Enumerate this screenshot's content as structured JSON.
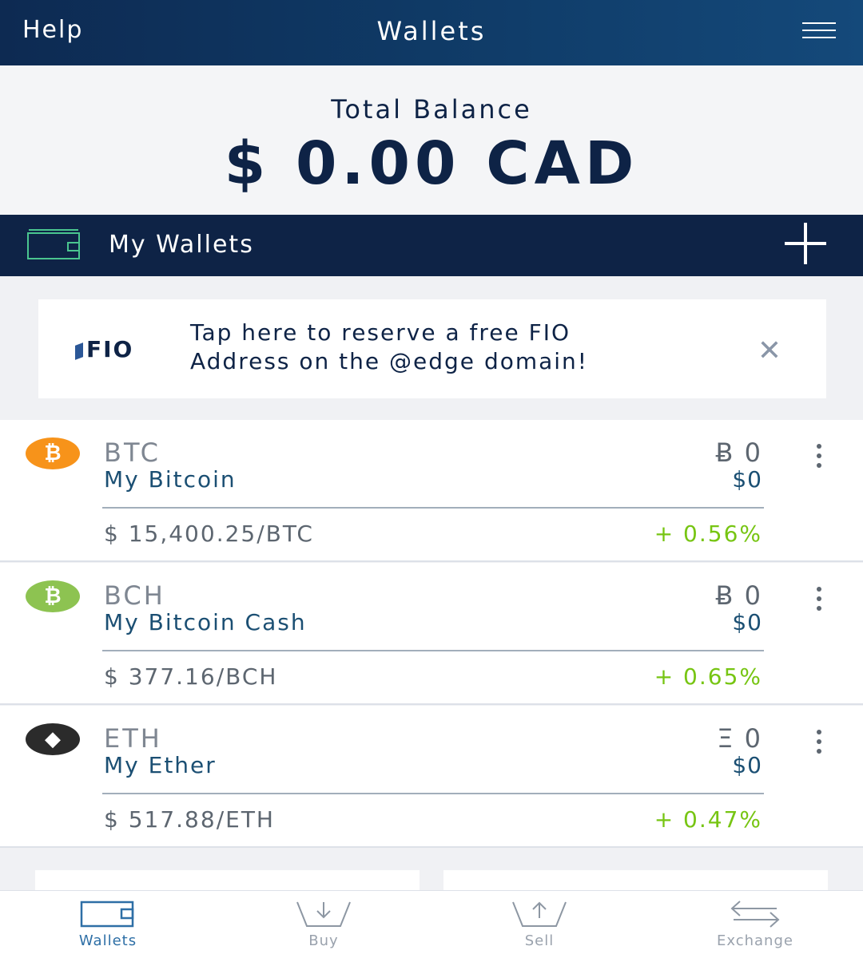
{
  "header": {
    "help_label": "Help",
    "title": "Wallets"
  },
  "balance": {
    "label": "Total Balance",
    "amount": "$ 0.00 CAD"
  },
  "wallets_bar": {
    "label": "My Wallets"
  },
  "fio_banner": {
    "logo_text": "FIO",
    "text_line1": "Tap here to reserve a free FIO",
    "text_line2": "Address on the @edge domain!"
  },
  "wallets": [
    {
      "ticker": "BTC",
      "name": "My Bitcoin",
      "balance": "Ƀ 0",
      "fiat": "$0",
      "rate": "$ 15,400.25/BTC",
      "change": "+ 0.56%",
      "icon": "bitcoin-icon",
      "icon_glyph": "₿",
      "color": "#f7931a"
    },
    {
      "ticker": "BCH",
      "name": "My Bitcoin Cash",
      "balance": "Ƀ 0",
      "fiat": "$0",
      "rate": "$ 377.16/BCH",
      "change": "+ 0.65%",
      "icon": "bitcoin-cash-icon",
      "icon_glyph": "₿",
      "color": "#8dc351"
    },
    {
      "ticker": "ETH",
      "name": "My Ether",
      "balance": "Ξ 0",
      "fiat": "$0",
      "rate": "$ 517.88/ETH",
      "change": "+ 0.47%",
      "icon": "ethereum-icon",
      "icon_glyph": "◆",
      "color": "#2b2b2b"
    }
  ],
  "tabs": [
    {
      "label": "Wallets",
      "icon": "wallet-icon",
      "active": true
    },
    {
      "label": "Buy",
      "icon": "buy-icon",
      "active": false
    },
    {
      "label": "Sell",
      "icon": "sell-icon",
      "active": false
    },
    {
      "label": "Exchange",
      "icon": "exchange-icon",
      "active": false
    }
  ],
  "colors": {
    "header_bg": "#0f3a66",
    "bar_bg": "#0e2346",
    "accent_green": "#77c513",
    "link_blue": "#1b4f73",
    "wallet_icon_green": "#4ac58f"
  }
}
